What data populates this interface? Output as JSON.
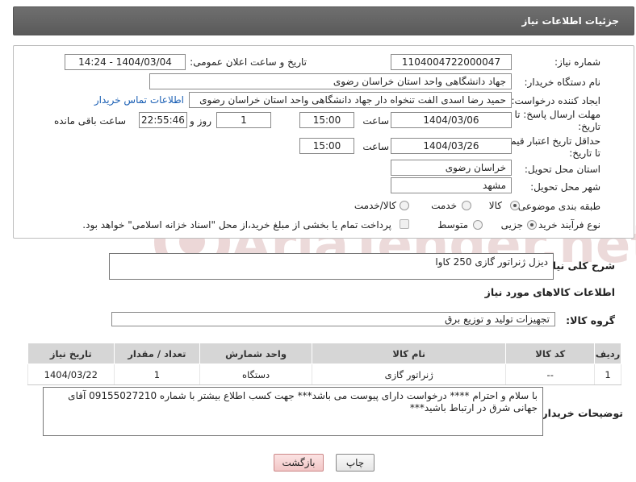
{
  "header": {
    "title": "جزئیات اطلاعات نیاز"
  },
  "form": {
    "need_number_label": "شماره نیاز:",
    "need_number": "1104004722000047",
    "announce_label": "تاریخ و ساعت اعلان عمومی:",
    "announce_value": "1404/03/04 - 14:24",
    "buyer_org_label": "نام دستگاه خریدار:",
    "buyer_org": "جهاد دانشگاهی واحد استان خراسان رضوی",
    "creator_label": "ایجاد کننده درخواست:",
    "creator": "حمید رضا اسدی الفت تنخواه دار جهاد دانشگاهی واحد استان خراسان رضوی",
    "contact_link": "اطلاعات تماس خریدار",
    "reply_deadline_label_1": "مهلت ارسال پاسخ: تا",
    "reply_deadline_label_2": "تاریخ:",
    "reply_date": "1404/03/06",
    "time_label": "ساعت",
    "reply_time": "15:00",
    "days": "1",
    "days_label": "روز و",
    "remaining": "22:55:46",
    "remaining_label": "ساعت باقی مانده",
    "price_deadline_label_1": "حداقل تاریخ اعتبار قیمت:",
    "price_deadline_label_2": "تا تاریخ:",
    "price_date": "1404/03/26",
    "price_time": "15:00",
    "province_label": "استان محل تحویل:",
    "province": "خراسان رضوی",
    "city_label": "شهر محل تحویل:",
    "city": "مشهد",
    "category_label": "طبقه بندی موضوعی:",
    "category_options": [
      "کالا",
      "خدمت",
      "کالا/خدمت"
    ],
    "process_label": "نوع فرآیند خرید :",
    "process_options": [
      "جزیی",
      "متوسط"
    ],
    "process_note": "پرداخت تمام یا بخشی از مبلغ خرید،از محل \"اسناد خزانه اسلامی\" خواهد بود."
  },
  "summary": {
    "label": "شرح کلی نیاز:",
    "value": "دیزل ژنراتور گازی 250 کاوا"
  },
  "goods_info_title": "اطلاعات کالاهای مورد نیاز",
  "goods_group": {
    "label": "گروه کالا:",
    "value": "تجهیزات تولید و توزیع برق"
  },
  "table": {
    "headers": [
      "ردیف",
      "کد کالا",
      "نام کالا",
      "واحد شمارش",
      "تعداد / مقدار",
      "تاریخ نیاز"
    ],
    "rows": [
      {
        "index": "1",
        "code": "--",
        "name": "ژنراتور گازی",
        "unit": "دستگاه",
        "qty": "1",
        "date": "1404/03/22"
      }
    ]
  },
  "buyer_notes": {
    "label": "توضیحات خریدار:",
    "value": "با سلام و احترام **** درخواست دارای پیوست می باشد*** جهت کسب اطلاع بیشتر با شماره 09155027210 آقای جهانی شرق در ارتباط باشید***"
  },
  "buttons": {
    "print": "چاپ",
    "back": "بازگشت"
  },
  "watermark": {
    "text": "AriaTender.net"
  },
  "colors": {
    "header": "#636363",
    "link": "#1a5fb4",
    "watermark": "#e3c9c9"
  }
}
